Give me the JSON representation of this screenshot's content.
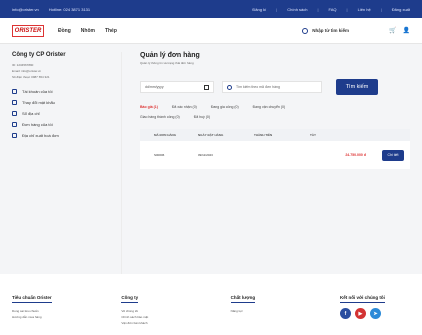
{
  "topbar": {
    "email": "info@orister.vn",
    "hotline": "Hotline: 024 3871 3131",
    "account": "Đăng kí",
    "policy": "Chính sách",
    "faq": "FAQ",
    "contact": "Liên hệ",
    "support": "Đăng xuất"
  },
  "header": {
    "logo": "ORISTER",
    "nav": [
      "Đồng",
      "Nhôm",
      "Thép"
    ],
    "search_label": "Nhập từ tìm kiếm"
  },
  "sidebar": {
    "company": "Công ty CP Orister",
    "meta": [
      "ID: 1234567890",
      "Email: info@orister.vn",
      "Số điện thoại: 0987 654 321"
    ],
    "items": [
      {
        "label": "Tài khoản của tôi"
      },
      {
        "label": "Thay đổi mật khẩu"
      },
      {
        "label": "Sổ địa chỉ"
      },
      {
        "label": "Đơn hàng của tôi"
      },
      {
        "label": "Địa chỉ xuất hoá đơn"
      }
    ]
  },
  "content": {
    "title": "Quản lý đơn hàng",
    "subtitle": "Quản lý thông tin và trạng thái đơn hàng",
    "date_placeholder": "dd/mm/yyyy",
    "search_placeholder": "Tìm kiếm theo mã đơn hàng",
    "search_button": "Tìm kiếm",
    "tabs": [
      {
        "label": "Báo giá (1)",
        "active": true
      },
      {
        "label": "Đã xác nhận (0)"
      },
      {
        "label": "Đang gia công (0)"
      },
      {
        "label": "Đang vận chuyển (0)"
      },
      {
        "label": "Giao hàng thành công (0)"
      },
      {
        "label": "Đã huỷ (0)"
      }
    ],
    "table": {
      "headers": [
        "Mã đơn hàng",
        "Ngày đặt hàng",
        "Thành tiền",
        "Tày"
      ],
      "rows": [
        {
          "code": "S00006",
          "date": "09/11/2023",
          "total": "24.750.000 đ",
          "action": "Chi tiết"
        }
      ]
    }
  },
  "footer": {
    "col1": {
      "title": "Tiêu chuẩn Orister",
      "links": [
        "Dung sai tiêu chuẩn",
        "Hướng dẫn mua hàng"
      ]
    },
    "col2": {
      "title": "Công ty",
      "links": [
        "Về chúng tôi",
        "Chính sách bảo mật",
        "Vận đơn bán khách"
      ]
    },
    "col3": {
      "title": "Chất lượng",
      "links": [
        "Năng lực"
      ]
    },
    "col4": {
      "title": "Kết nối với chúng tôi"
    }
  },
  "colors": {
    "primary": "#1e3c8c",
    "accent": "#d33333",
    "facebook": "#2a4ea0",
    "youtube": "#d33333",
    "telegram": "#2c8ad8"
  }
}
